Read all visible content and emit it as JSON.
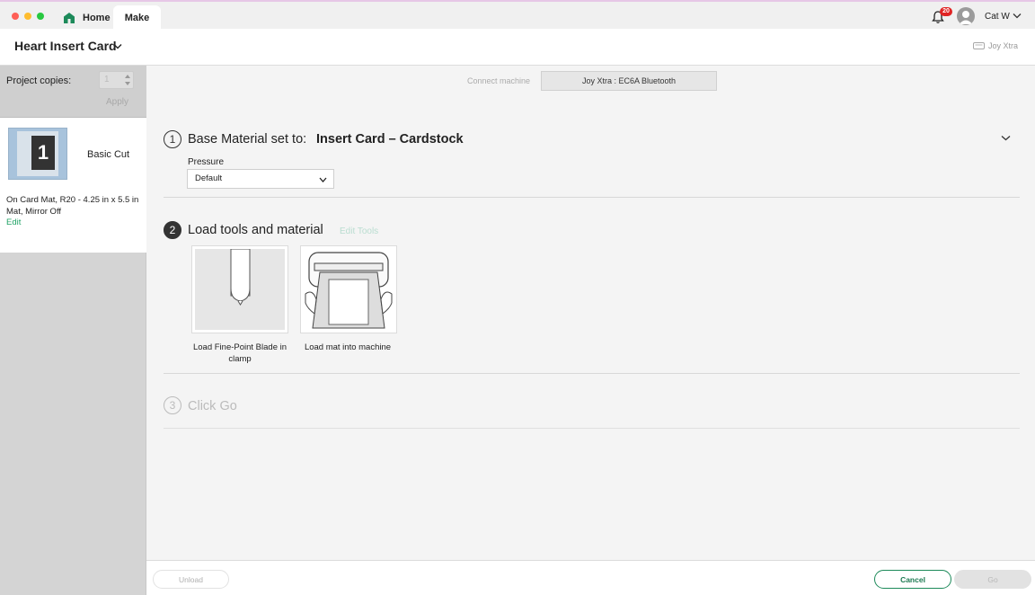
{
  "titlebar": {
    "tabs": [
      {
        "label": "Home",
        "icon": "home-icon"
      },
      {
        "label": "Make"
      }
    ],
    "notifications": {
      "icon": "bell-icon",
      "count": "20"
    },
    "user": {
      "name": "Cat W",
      "icon": "avatar"
    }
  },
  "header": {
    "project_title": "Heart Insert Card",
    "machine_name": "Joy Xtra"
  },
  "sidebar": {
    "copies_label": "Project copies:",
    "copies_value": "1",
    "apply_label": "Apply",
    "mat": {
      "number": "1",
      "cut_type": "Basic Cut",
      "description": "On Card Mat, R20 - 4.25 in x 5.5 in Mat, Mirror Off",
      "edit_label": "Edit"
    }
  },
  "main": {
    "connect_label": "Connect machine",
    "connected_machine": "Joy Xtra : EC6A Bluetooth",
    "step1": {
      "number": "1",
      "title": "Base Material set to:",
      "value": "Insert Card – Cardstock",
      "pressure_label": "Pressure",
      "pressure_value": "Default"
    },
    "step2": {
      "number": "2",
      "title": "Load tools and material",
      "edit_tools_label": "Edit Tools",
      "cards": [
        {
          "label": "Load Fine-Point Blade in clamp"
        },
        {
          "label": "Load mat into machine"
        }
      ]
    },
    "step3": {
      "number": "3",
      "title": "Click Go"
    }
  },
  "footer": {
    "unload_label": "Unload",
    "cancel_label": "Cancel",
    "go_label": "Go"
  },
  "colors": {
    "accent_green": "#1d7a52",
    "badge_red": "#e02424",
    "sidebar_gray": "#d4d4d4"
  }
}
